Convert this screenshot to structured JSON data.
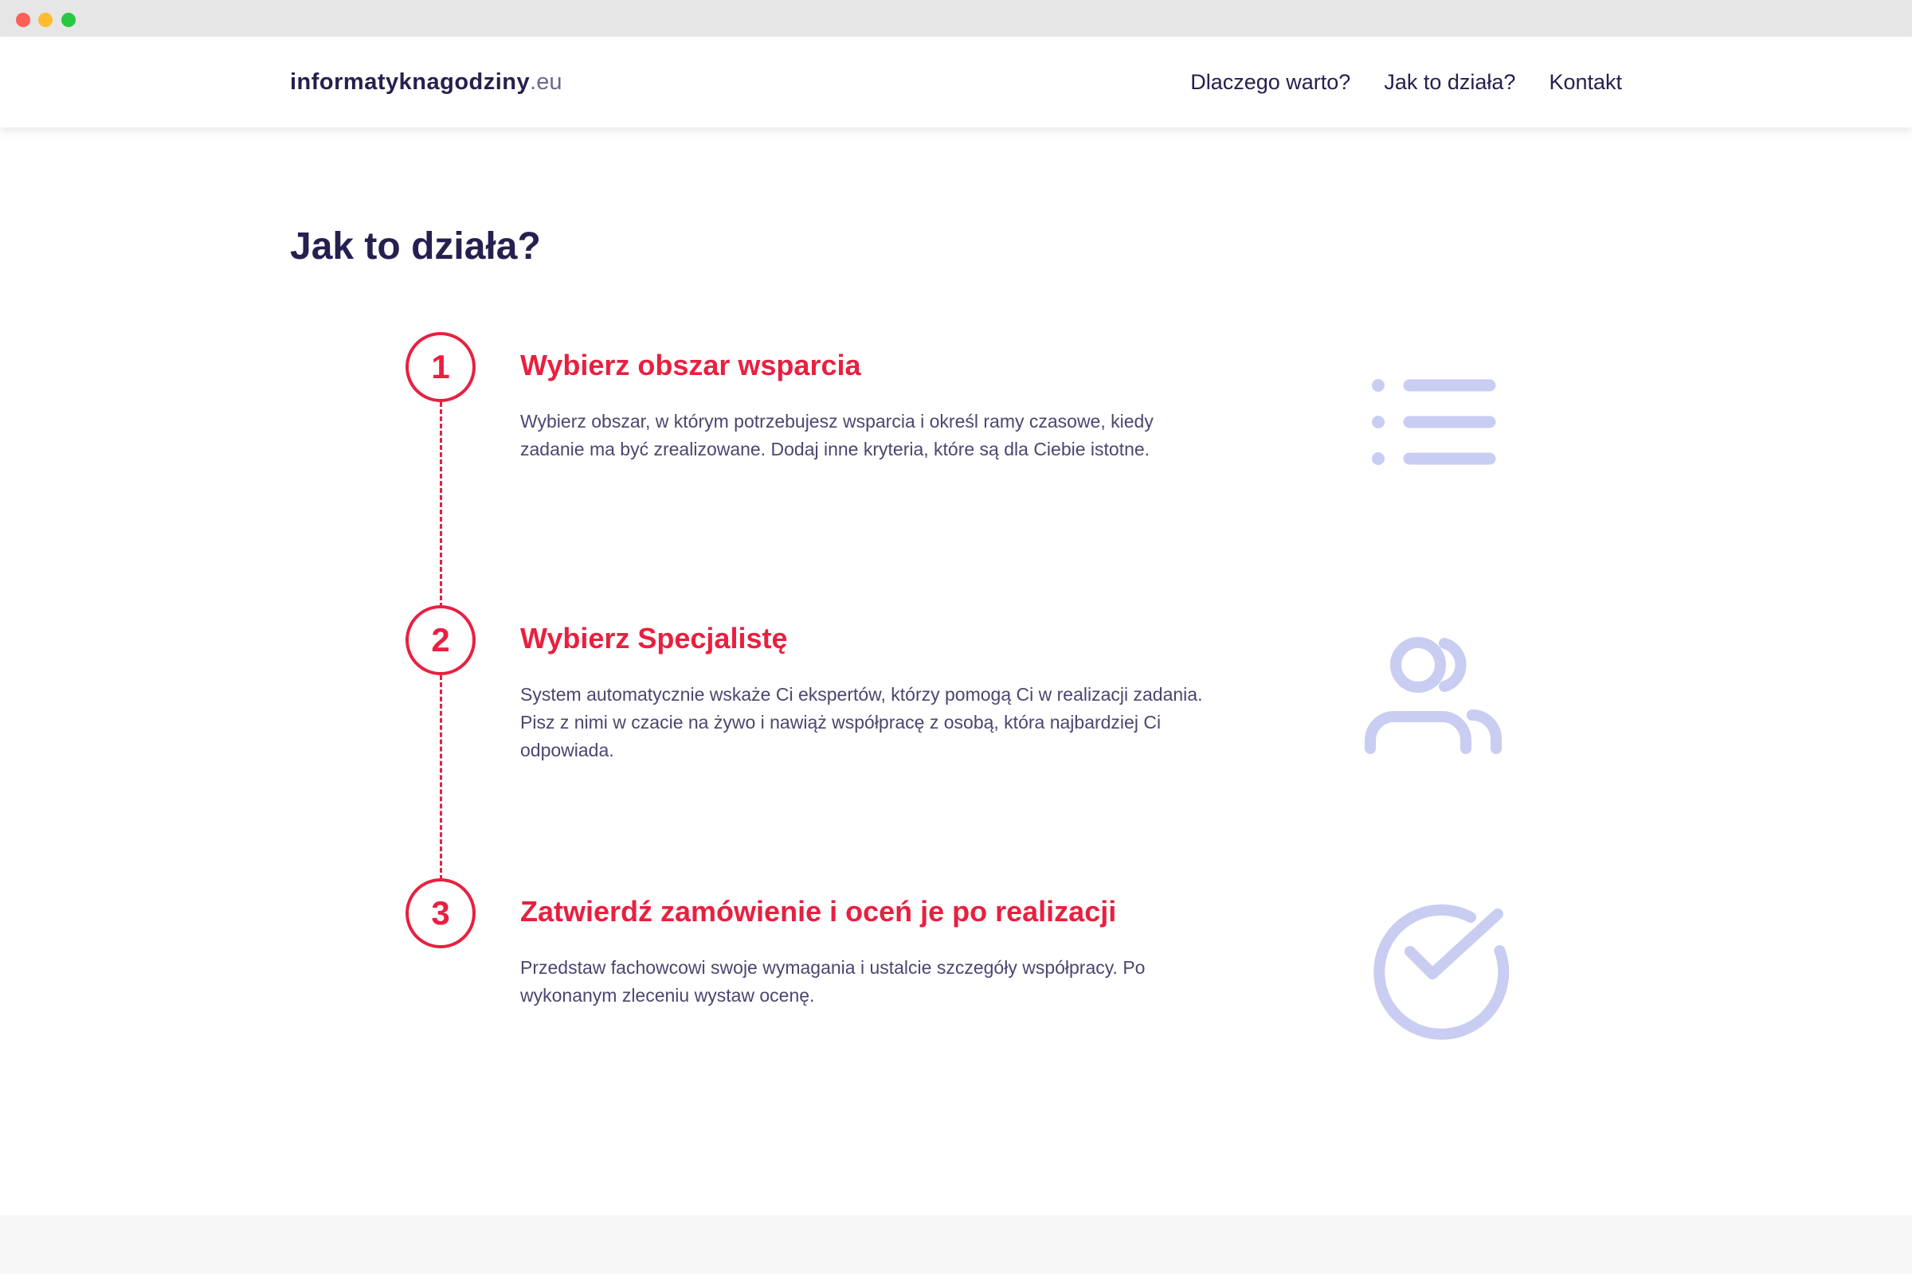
{
  "header": {
    "logo_name": "informatyknagodziny",
    "logo_tld": ".eu",
    "nav": [
      {
        "label": "Dlaczego warto?"
      },
      {
        "label": "Jak to działa?"
      },
      {
        "label": "Kontakt"
      }
    ]
  },
  "section": {
    "title": "Jak to działa?",
    "steps": [
      {
        "number": "1",
        "title": "Wybierz obszar wsparcia",
        "description": "Wybierz obszar, w którym potrzebujesz wsparcia i określ ramy czasowe, kiedy zadanie ma być zrealizowane. Dodaj inne kryteria, które są dla Ciebie istotne.",
        "icon": "list-icon"
      },
      {
        "number": "2",
        "title": "Wybierz Specjalistę",
        "description": "System automatycznie wskaże Ci ekspertów, którzy pomogą Ci w realizacji zadania. Pisz z nimi w czacie na żywo i nawiąż współpracę z osobą, która najbardziej Ci odpowiada.",
        "icon": "users-icon"
      },
      {
        "number": "3",
        "title": "Zatwierdź zamówienie i oceń je po realizacji",
        "description": "Przedstaw fachowcowi swoje wymagania i ustalcie szczegóły współpracy. Po wykonanym zleceniu wystaw ocenę.",
        "icon": "check-circle-icon"
      }
    ]
  },
  "colors": {
    "primary_dark": "#25204f",
    "accent_red": "#e8203f",
    "icon_lavender": "#c9cdf2",
    "text_body": "#4a4670"
  }
}
